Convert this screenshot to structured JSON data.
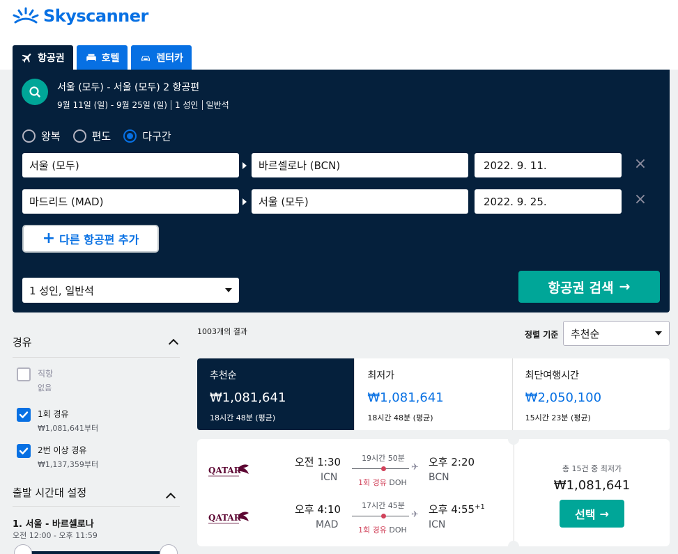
{
  "brand": {
    "name": "Skyscanner",
    "color": "#0770e3"
  },
  "tabs": [
    {
      "label": "항공권",
      "icon": "plane-icon",
      "active": true
    },
    {
      "label": "호텔",
      "icon": "bed-icon",
      "active": false
    },
    {
      "label": "렌터카",
      "icon": "car-icon",
      "active": false
    }
  ],
  "summary": {
    "title": "서울 (모두) - 서울 (모두) 2 항공편",
    "dates": "9월 11일 (일) - 9월 25일 (일)",
    "pax": "1 성인",
    "cabin": "일반석"
  },
  "trip_types": [
    {
      "label": "왕복",
      "checked": false
    },
    {
      "label": "편도",
      "checked": false
    },
    {
      "label": "다구간",
      "checked": true
    }
  ],
  "legs": [
    {
      "from": "서울 (모두)",
      "to": "바르셀로나 (BCN)",
      "date": "2022. 9. 11."
    },
    {
      "from": "마드리드 (MAD)",
      "to": "서울 (모두)",
      "date": "2022. 9. 25."
    }
  ],
  "add_flight_label": "다른 항공편 추가",
  "pax_select": "1 성인, 일반석",
  "search_button": "항공권 검색",
  "filters": {
    "stops_title": "경유",
    "options": [
      {
        "label": "직항",
        "sub": "없음",
        "checked": false,
        "disabled": true
      },
      {
        "label": "1회 경유",
        "sub": "₩1,081,641부터",
        "checked": true,
        "disabled": false
      },
      {
        "label": "2번 이상 경유",
        "sub": "₩1,137,359부터",
        "checked": true,
        "disabled": false
      }
    ],
    "time_title": "출발 시간대 설정",
    "route": "1. 서울 - 바르셀로나",
    "time_range": "오전 12:00 - 오후 11:59"
  },
  "results": {
    "count": "1003개의 결과",
    "sort_label": "정렬 기준",
    "sort_value": "추천순"
  },
  "sort_tabs": [
    {
      "title": "추천순",
      "price": "₩1,081,641",
      "duration": "18시간 48분 (평균)",
      "active": true
    },
    {
      "title": "최저가",
      "price": "₩1,081,641",
      "duration": "18시간 48분 (평균)",
      "active": false
    },
    {
      "title": "최단여행시간",
      "price": "₩2,050,100",
      "duration": "15시간 23분 (평균)",
      "active": false
    }
  ],
  "card": {
    "airline": "QATAR",
    "legs": [
      {
        "dep_time": "오전 1:30",
        "dep_code": "ICN",
        "duration": "19시간 50분",
        "stops": "1회 경유",
        "via": "DOH",
        "arr_time": "오후 2:20",
        "arr_sup": "",
        "arr_code": "BCN"
      },
      {
        "dep_time": "오후 4:10",
        "dep_code": "MAD",
        "duration": "17시간 45분",
        "stops": "1회 경유",
        "via": "DOH",
        "arr_time": "오후 4:55",
        "arr_sup": "+1",
        "arr_code": "ICN"
      }
    ],
    "deal_label": "총 15건 중 최저가",
    "price": "₩1,081,641",
    "select_label": "선택"
  }
}
